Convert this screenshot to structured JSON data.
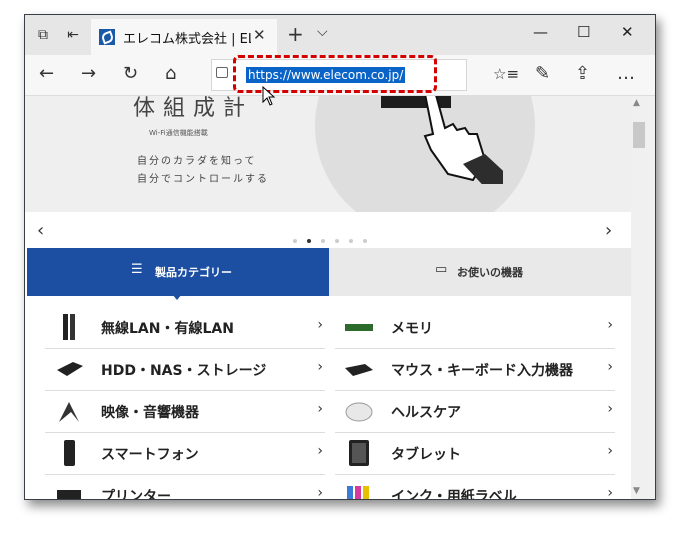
{
  "tab": {
    "title": "エレコム株式会社 | ELECC"
  },
  "address_bar": {
    "url": "https://www.elecom.co.jp/"
  },
  "hero": {
    "title": "体組成計",
    "subtitle": "Wi-Fi通信機能搭載",
    "line1": "自分のカラダを知って",
    "line2": "自分でコントロールする"
  },
  "category_tabs": {
    "products": "製品カテゴリー",
    "devices": "お使いの機器"
  },
  "left_items": [
    "無線LAN・有線LAN",
    "HDD・NAS・ストレージ",
    "映像・音響機器",
    "スマートフォン",
    "プリンター"
  ],
  "right_items": [
    "メモリ",
    "マウス・キーボード入力機器",
    "ヘルスケア",
    "タブレット",
    "インク・用紙ラベル"
  ],
  "icons": {
    "window": [
      "tab-set-aside-icon",
      "back-tabs-icon",
      "new-tab-icon",
      "tab-dropdown-icon",
      "minimize-icon",
      "maximize-icon",
      "close-window-icon"
    ],
    "nav": [
      "back-icon",
      "forward-icon",
      "refresh-icon",
      "home-icon",
      "favorites-icon",
      "pen-icon",
      "share-icon",
      "more-icon"
    ]
  },
  "colors": {
    "accent_blue": "#1c4ea1",
    "url_highlight": "#0a64c8",
    "callout_red": "#d40000"
  }
}
